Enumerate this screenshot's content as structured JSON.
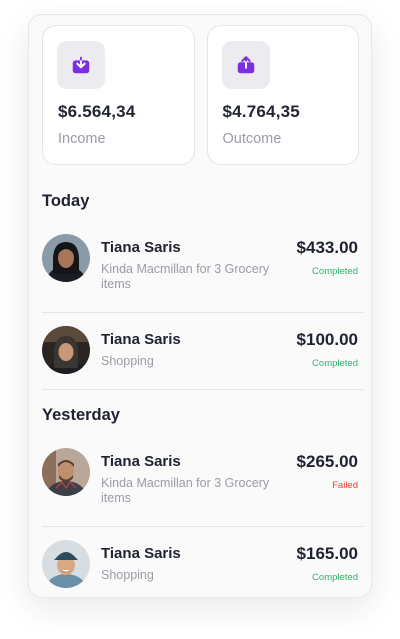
{
  "stats": [
    {
      "amount": "$6.564,34",
      "label": "Income",
      "icon": "download-icon"
    },
    {
      "amount": "$4.764,35",
      "label": "Outcome",
      "icon": "upload-icon"
    }
  ],
  "colors": {
    "accent": "#7b2fe0",
    "completed": "#2fb36b",
    "failed": "#e3412f"
  },
  "sections": [
    {
      "title": "Today",
      "transactions": [
        {
          "name": "Tiana Saris",
          "description": "Kinda Macmillan for 3 Grocery items",
          "amount": "$433.00",
          "status": "Completed"
        },
        {
          "name": "Tiana Saris",
          "description": "Shopping",
          "amount": "$100.00",
          "status": "Completed"
        }
      ]
    },
    {
      "title": "Yesterday",
      "transactions": [
        {
          "name": "Tiana Saris",
          "description": "Kinda Macmillan for 3 Grocery items",
          "amount": "$265.00",
          "status": "Failed"
        },
        {
          "name": "Tiana Saris",
          "description": "Shopping",
          "amount": "$165.00",
          "status": "Completed"
        }
      ]
    }
  ]
}
